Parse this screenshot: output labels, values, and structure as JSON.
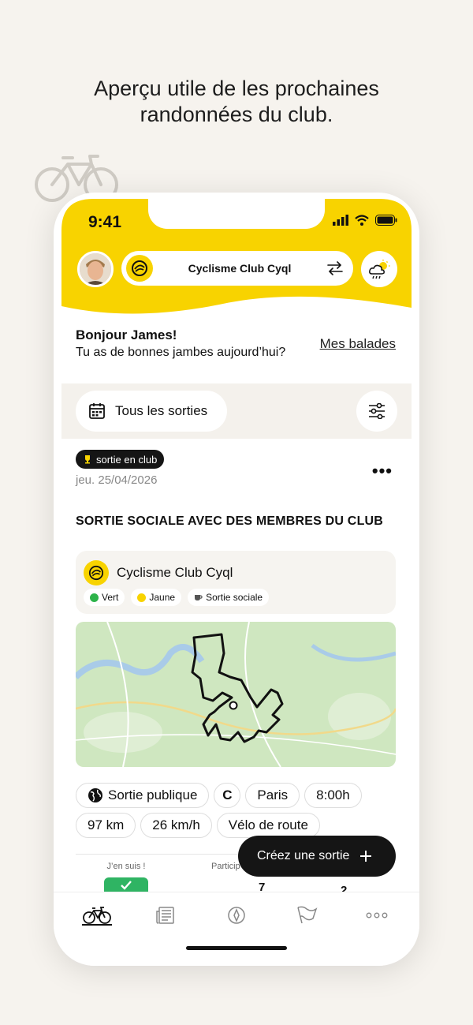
{
  "promo": {
    "headline_line1": "Aperçu utile de les prochaines",
    "headline_line2": "randonnées du club."
  },
  "status_bar": {
    "time": "9:41"
  },
  "header": {
    "club_name": "Cyclisme Club Cyql",
    "icons": [
      "avatar",
      "club-logo-icon",
      "swap-icon",
      "weather-cloud-sun-icon"
    ]
  },
  "greeting": {
    "title": "Bonjour James!",
    "subtitle": "Tu as de bonnes jambes aujourd’hui?",
    "link": "Mes balades"
  },
  "filter": {
    "label": "Tous les sorties"
  },
  "ride": {
    "badge": "sortie en club",
    "date": "jeu. 25/04/2026",
    "title": "SORTIE SOCIALE AVEC DES MEMBRES DU CLUB",
    "club": "Cyclisme Club Cyql",
    "tags": [
      {
        "label": "Vert",
        "color": "#2db34a"
      },
      {
        "label": "Jaune",
        "color": "#f8d300"
      },
      {
        "label": "Sortie sociale",
        "icon": "coffee-icon"
      }
    ],
    "chips_row1": [
      "Sortie publique",
      "C",
      "Paris",
      "8:00h"
    ],
    "chips_row2": [
      "97 km",
      "26 km/h",
      "Vélo de route"
    ],
    "join_label": "J’en suis !",
    "participants_label": "Particip",
    "count1": "7",
    "count2": "2"
  },
  "fab": {
    "label": "Créez une sortie"
  },
  "tabbar": {
    "icons": [
      "bike-icon",
      "news-icon",
      "compass-icon",
      "flag-icon",
      "more-icon"
    ],
    "active": "bike-icon"
  },
  "colors": {
    "brand_yellow": "#f8d300",
    "dark": "#151515",
    "join_green": "#2fb463"
  }
}
